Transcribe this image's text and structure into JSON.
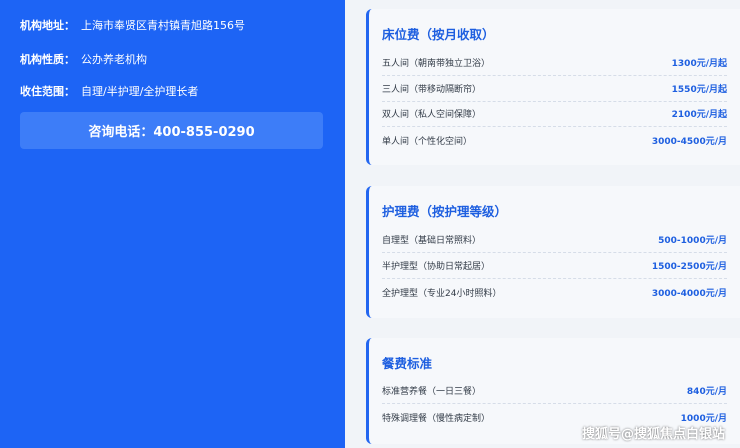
{
  "info": {
    "address_label": "机构地址：",
    "address_value": "上海市奉贤区青村镇青旭路156号",
    "type_label": "机构性质：",
    "type_value": "公办养老机构",
    "scope_label": "收住范围：",
    "scope_value": "自理/半护理/全护理长者",
    "consult_text": "咨询电话：400-855-0290"
  },
  "bed_card": {
    "title": "床位费（按月收取）",
    "items": [
      {
        "name": "五人间（朝南带独立卫浴）",
        "price": "1300元/月起"
      },
      {
        "name": "三人间（带移动隔断帘）",
        "price": "1550元/月起"
      },
      {
        "name": "双人间（私人空间保障）",
        "price": "2100元/月起"
      },
      {
        "name": "单人间（个性化空间）",
        "price": "3000-4500元/月"
      }
    ]
  },
  "care_card": {
    "title": "护理费（按护理等级）",
    "items": [
      {
        "name": "自理型（基础日常照料）",
        "price": "500-1000元/月"
      },
      {
        "name": "半护理型（协助日常起居）",
        "price": "1500-2500元/月"
      },
      {
        "name": "全护理型（专业24小时照料）",
        "price": "3000-4000元/月"
      }
    ]
  },
  "meal_card": {
    "title": "餐费标准",
    "items": [
      {
        "name": "标准营养餐（一日三餐）",
        "price": "840元/月"
      },
      {
        "name": "特殊调理餐（慢性病定制）",
        "price": "1000元/月"
      }
    ]
  },
  "watermark": "搜狐号@搜狐焦点白银站",
  "colors": {
    "left_bg": "#1d64f5",
    "accent": "#1e5fe0",
    "card_bg": "#f6f8fb"
  }
}
